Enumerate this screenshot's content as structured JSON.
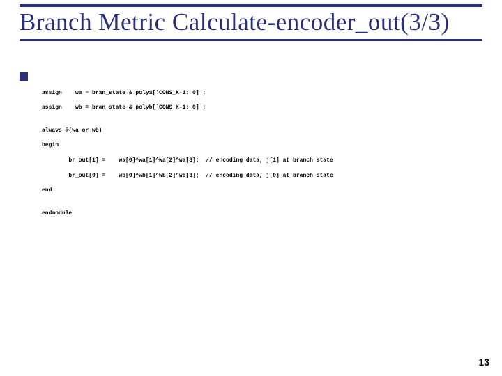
{
  "title": "Branch Metric Calculate-encoder_out(3/3)",
  "code": {
    "l1": "assign    wa = bran_state & polya[`CONS_K-1: 0] ;",
    "l2": "assign    wb = bran_state & polyb[`CONS_K-1: 0] ;",
    "l3": "",
    "l4": "always @(wa or wb)",
    "l5": "begin",
    "l6": "        br_out[1] =    wa[0]^wa[1]^wa[2]^wa[3];  // encoding data, j[1] at branch state",
    "l7": "        br_out[0] =    wb[0]^wb[1]^wb[2]^wb[3];  // encoding data, j[0] at branch state",
    "l8": "end",
    "l9": "",
    "l10": "endmodule"
  },
  "page": "13"
}
